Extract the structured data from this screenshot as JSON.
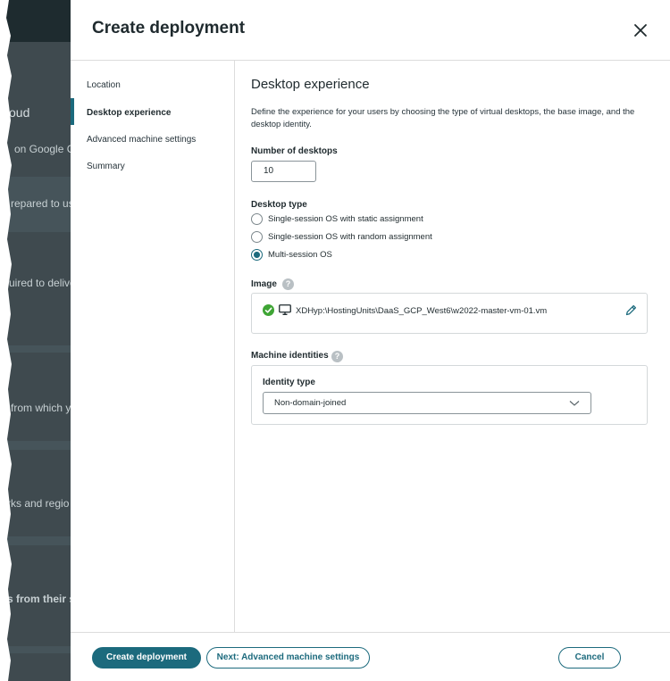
{
  "background": {
    "fragments": [
      {
        "text": "oud",
        "style": "heading"
      },
      {
        "text": "on Google Cl",
        "style": "normal"
      },
      {
        "text": "repared to us",
        "style": "normal"
      },
      {
        "text": "uired to delive",
        "style": "normal"
      },
      {
        "text": "from which yo",
        "style": "normal"
      },
      {
        "text": "rks and regio",
        "style": "normal"
      },
      {
        "text": "s from their s",
        "style": "bold"
      }
    ]
  },
  "modal": {
    "title": "Create deployment",
    "close_icon": "close-icon"
  },
  "nav": {
    "items": [
      {
        "label": "Location",
        "active": false
      },
      {
        "label": "Desktop experience",
        "active": true
      },
      {
        "label": "Advanced machine settings",
        "active": false
      },
      {
        "label": "Summary",
        "active": false
      }
    ]
  },
  "content": {
    "title": "Desktop experience",
    "description": "Define the experience for your users by choosing the type of virtual desktops, the base image, and the desktop identity.",
    "num_desktops": {
      "label": "Number of desktops",
      "value": "10"
    },
    "desktop_type": {
      "label": "Desktop type",
      "options": [
        {
          "label": "Single-session OS with static assignment",
          "checked": false
        },
        {
          "label": "Single-session OS with random assignment",
          "checked": false
        },
        {
          "label": "Multi-session OS",
          "checked": true
        }
      ]
    },
    "image": {
      "label": "Image",
      "help": "?",
      "path": "XDHyp:\\HostingUnits\\DaaS_GCP_West6\\w2022-master-vm-01.vm",
      "status_icon": "check-circle-icon",
      "type_icon": "monitor-icon",
      "edit_icon": "pencil-icon"
    },
    "machine_identities": {
      "label": "Machine identities",
      "help": "?",
      "identity_type_label": "Identity type",
      "identity_type_value": "Non-domain-joined"
    }
  },
  "footer": {
    "create_label": "Create deployment",
    "next_label": "Next: Advanced machine settings",
    "cancel_label": "Cancel"
  },
  "colors": {
    "accent": "#1c6a7d",
    "success": "#3fa535",
    "overlay": "#3f4a4f"
  }
}
